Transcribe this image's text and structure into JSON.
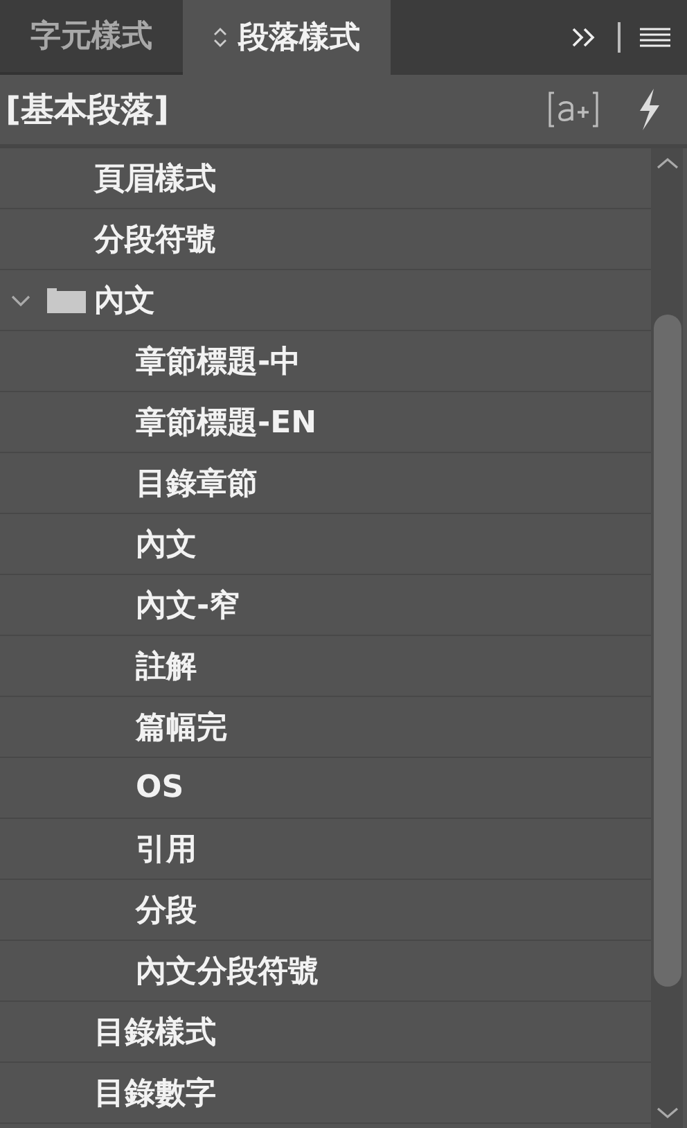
{
  "tabs": [
    {
      "label": "字元樣式",
      "selected": false
    },
    {
      "label": "段落樣式",
      "selected": true
    }
  ],
  "current_style": "[基本段落]",
  "styles": [
    {
      "label": "頁眉樣式",
      "kind": "style"
    },
    {
      "label": "分段符號",
      "kind": "style"
    },
    {
      "label": "內文",
      "kind": "group",
      "expanded": true,
      "children": [
        {
          "label": "章節標題-中",
          "kind": "style"
        },
        {
          "label": "章節標題-EN",
          "kind": "style"
        },
        {
          "label": "目錄章節",
          "kind": "style"
        },
        {
          "label": "內文",
          "kind": "style"
        },
        {
          "label": "內文-窄",
          "kind": "style"
        },
        {
          "label": "註解",
          "kind": "style"
        },
        {
          "label": "篇幅完",
          "kind": "style"
        },
        {
          "label": "OS",
          "kind": "style"
        },
        {
          "label": "引用",
          "kind": "style"
        },
        {
          "label": "分段",
          "kind": "style"
        },
        {
          "label": "內文分段符號",
          "kind": "style"
        }
      ]
    },
    {
      "label": "目錄樣式",
      "kind": "style"
    },
    {
      "label": "目錄數字",
      "kind": "style"
    }
  ]
}
